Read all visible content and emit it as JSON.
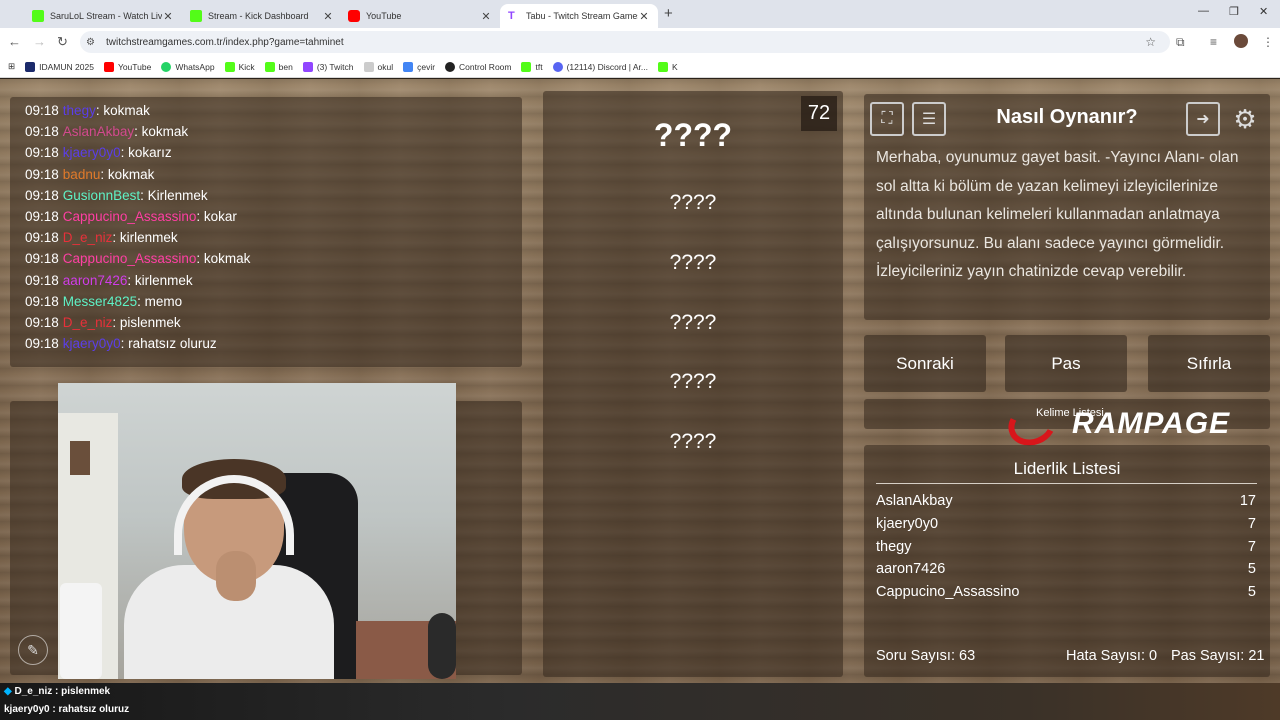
{
  "browser": {
    "tabs": [
      {
        "title": "SaruLoL Stream - Watch Live on",
        "color": "#53fc18",
        "active": false
      },
      {
        "title": "Stream - Kick Dashboard",
        "color": "#53fc18",
        "active": false
      },
      {
        "title": "YouTube",
        "color": "#ff0000",
        "active": false
      },
      {
        "title": "Tabu - Twitch Stream Games",
        "color": "#9146ff",
        "active": true
      }
    ],
    "new_tab": "+",
    "url": "twitchstreamgames.com.tr/index.php?game=tahminet",
    "bookmarks": [
      {
        "label": "IDAMUN 2025",
        "color": "#1b2a6b"
      },
      {
        "label": "YouTube",
        "color": "#ff0000"
      },
      {
        "label": "WhatsApp",
        "color": "#25d366"
      },
      {
        "label": "Kick",
        "color": "#53fc18"
      },
      {
        "label": "ben",
        "color": "#53fc18"
      },
      {
        "label": "(3) Twitch",
        "color": "#9146ff"
      },
      {
        "label": "okul",
        "color": "#cccccc"
      },
      {
        "label": "çevir",
        "color": "#4285f4"
      },
      {
        "label": "Control Room",
        "color": "#222222"
      },
      {
        "label": "tft",
        "color": "#53fc18"
      },
      {
        "label": "(12114) Discord | Ar...",
        "color": "#5865f2"
      },
      {
        "label": "K",
        "color": "#53fc18"
      }
    ]
  },
  "chat": {
    "messages": [
      {
        "time": "09:18",
        "user": "thegy",
        "color": "#5b3ee8",
        "text": ": kokmak"
      },
      {
        "time": "09:18",
        "user": "AslanAkbay",
        "color": "#d24a8e",
        "text": ": kokmak"
      },
      {
        "time": "09:18",
        "user": "kjaery0y0",
        "color": "#5b3ee8",
        "text": ": kokarız"
      },
      {
        "time": "09:18",
        "user": "badnu",
        "color": "#e07a2a",
        "text": ": kokmak"
      },
      {
        "time": "09:18",
        "user": "GusionnBest",
        "color": "#5ff2c6",
        "text": ": Kirlenmek"
      },
      {
        "time": "09:18",
        "user": "Cappucino_Assassino",
        "color": "#ff3fa4",
        "text": ": kokar"
      },
      {
        "time": "09:18",
        "user": "D_e_niz",
        "color": "#e8303a",
        "text": ": kirlenmek"
      },
      {
        "time": "09:18",
        "user": "Cappucino_Assassino",
        "color": "#ff3fa4",
        "text": ": kokmak"
      },
      {
        "time": "09:18",
        "user": "aaron7426",
        "color": "#d03de8",
        "text": ": kirlenmek"
      },
      {
        "time": "09:18",
        "user": "Messer4825",
        "color": "#5ff2c6",
        "text": ": memo"
      },
      {
        "time": "09:18",
        "user": "D_e_niz",
        "color": "#e8303a",
        "text": ": pislenmek"
      },
      {
        "time": "09:18",
        "user": "kjaery0y0",
        "color": "#5b3ee8",
        "text": ": rahatsız oluruz"
      }
    ]
  },
  "game": {
    "timer": "72",
    "main_word": "????",
    "forbidden_words": [
      "????",
      "????",
      "????",
      "????",
      "????"
    ]
  },
  "howto": {
    "title": "Nasıl Oynanır?",
    "text": "Merhaba, oyunumuz gayet basit. -Yayıncı Alanı- olan sol altta ki bölüm de yazan kelimeyi izleyicilerinize altında bulunan kelimeleri kullanmadan anlatmaya çalışıyorsunuz. Bu alanı sadece yayıncı görmelidir. İzleyicileriniz yayın chatinizde cevap verebilir."
  },
  "controls": {
    "next": "Sonraki",
    "pass": "Pas",
    "reset": "Sıfırla"
  },
  "category": {
    "label": "Kelime Listesi"
  },
  "rampage": {
    "label": "RAMPAGE"
  },
  "leaderboard": {
    "title": "Liderlik Listesi",
    "rows": [
      {
        "name": "AslanAkbay",
        "score": "17"
      },
      {
        "name": "kjaery0y0",
        "score": "7"
      },
      {
        "name": "thegy",
        "score": "7"
      },
      {
        "name": "aaron7426",
        "score": "5"
      },
      {
        "name": "Cappucino_Assassino",
        "score": "5"
      }
    ],
    "stats": {
      "questions": "Soru Sayısı: 63",
      "errors": "Hata Sayısı: 0",
      "passes": "Pas Sayısı: 21"
    }
  },
  "overlay_chat": [
    {
      "user": "D_e_niz",
      "text": " : pislenmek",
      "color": "#00b4ff"
    },
    {
      "user": "kjaery0y0",
      "text": " : rahatsız oluruz",
      "color": "#ff3fa4"
    }
  ]
}
